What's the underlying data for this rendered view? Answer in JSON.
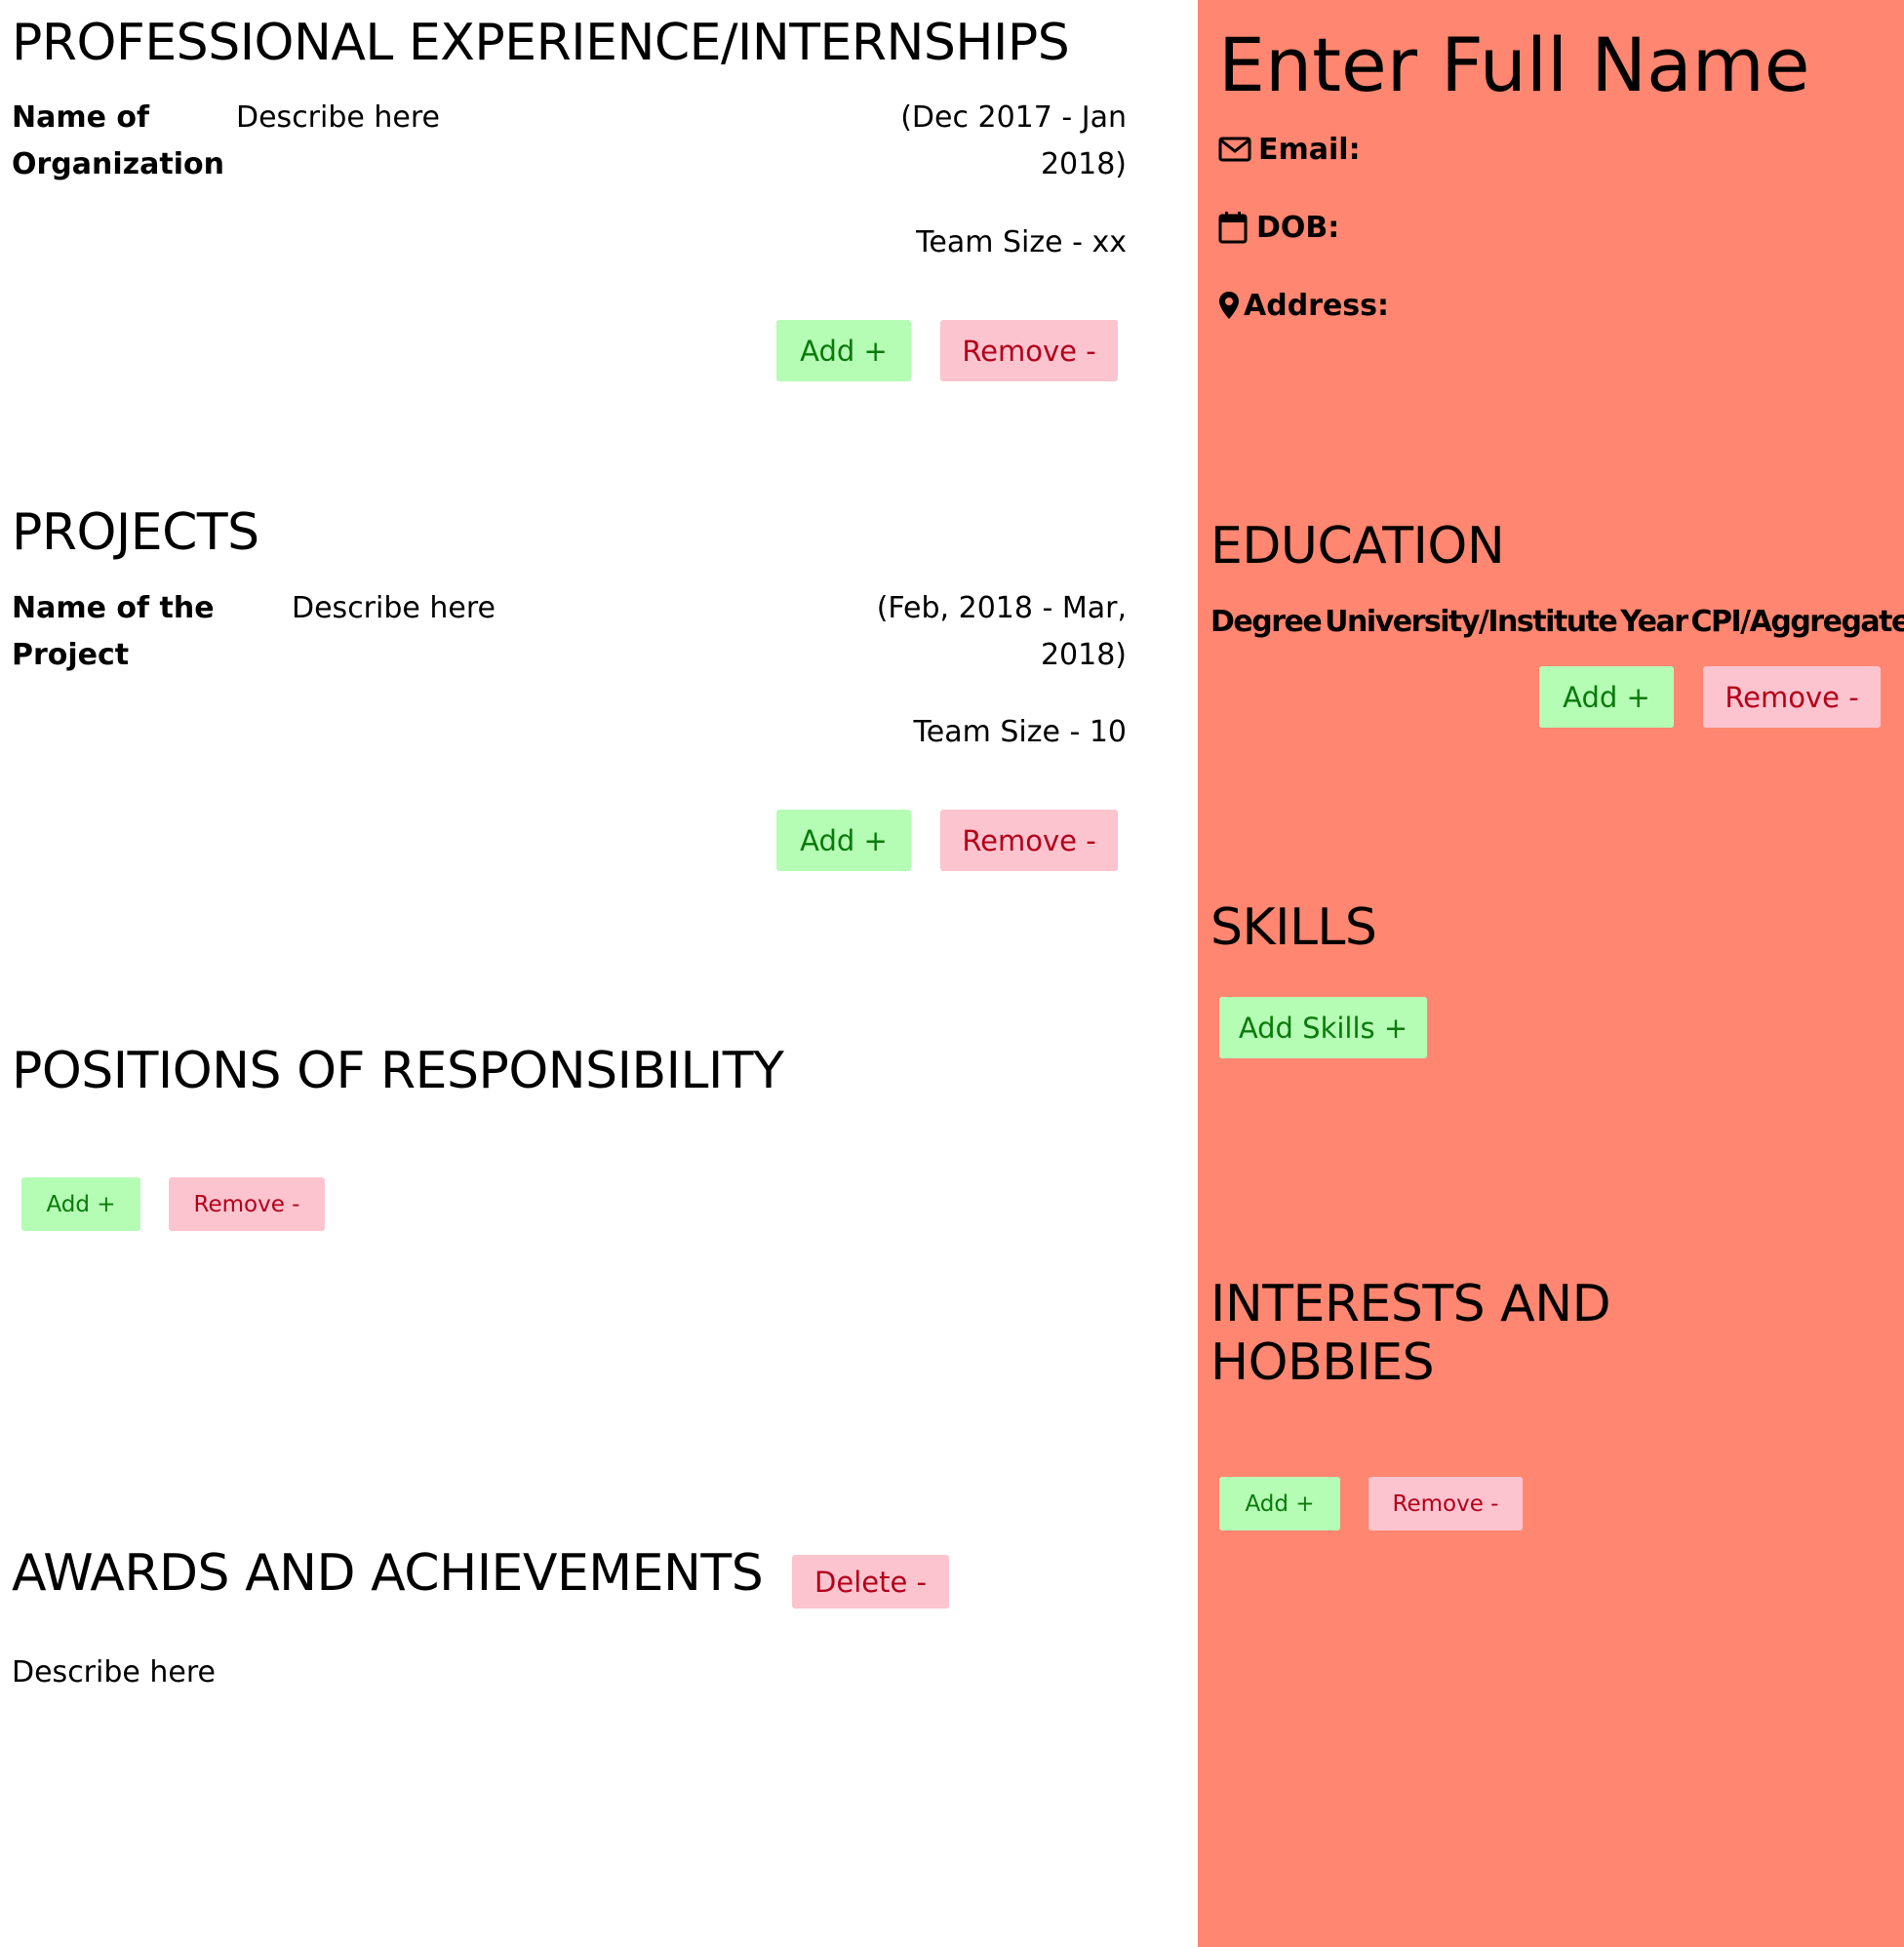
{
  "colors": {
    "sidebar_bg": "#ff8670",
    "add_bg": "#b5fcb5",
    "add_text": "#0a7a0a",
    "remove_bg": "#fcc4cf",
    "remove_text": "#b3001b"
  },
  "experience": {
    "heading": "PROFESSIONAL EXPERIENCE/INTERNSHIPS",
    "org_line1": "Name of",
    "org_line2": "Organization",
    "description": "Describe here",
    "date_line1": "(Dec 2017 - Jan",
    "date_line2": "2018)",
    "team_size": "Team Size - xx",
    "add_label": "Add +",
    "remove_label": "Remove -"
  },
  "projects": {
    "heading": "PROJECTS",
    "name_line1": "Name of the",
    "name_line2": "Project",
    "description": "Describe here",
    "date_line1": "(Feb, 2018 - Mar,",
    "date_line2": "2018)",
    "team_size": "Team Size - 10",
    "add_label": "Add +",
    "remove_label": "Remove -"
  },
  "positions": {
    "heading": "POSITIONS OF RESPONSIBILITY",
    "add_label": "Add +",
    "remove_label": "Remove -"
  },
  "awards": {
    "heading": "AWARDS AND ACHIEVEMENTS",
    "delete_label": "Delete -",
    "description": "Describe here"
  },
  "sidebar": {
    "full_name": "Enter Full Name",
    "email_label": "Email:",
    "email_icon": "envelope-icon",
    "dob_label": "DOB:",
    "dob_icon": "calendar-icon",
    "address_label": "Address:",
    "address_icon": "map-marker-icon",
    "education": {
      "heading": "EDUCATION",
      "columns": [
        "Degree",
        "University/Institute",
        "Year",
        "CPI/Aggregate"
      ],
      "add_label": "Add +",
      "remove_label": "Remove -"
    },
    "skills": {
      "heading": "SKILLS",
      "add_label": "Add Skills +"
    },
    "interests": {
      "heading_line1": "INTERESTS AND",
      "heading_line2": "HOBBIES",
      "add_label": "Add +",
      "remove_label": "Remove -"
    }
  }
}
